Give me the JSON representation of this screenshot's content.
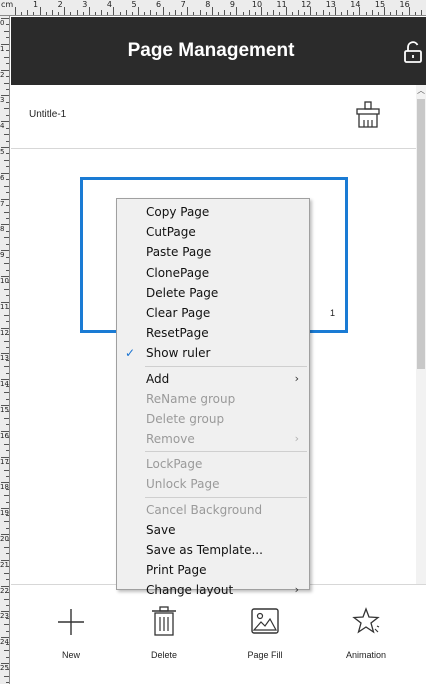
{
  "ruler": {
    "unit": "cm",
    "top_numbers": [
      "0",
      "1",
      "2",
      "3",
      "4",
      "5",
      "6",
      "7",
      "8",
      "9",
      "10",
      "11",
      "12",
      "13",
      "14",
      "15",
      "16"
    ],
    "left_numbers": [
      "0",
      "1",
      "2",
      "3",
      "4",
      "5",
      "6",
      "7",
      "8",
      "9",
      "10",
      "11",
      "12",
      "13",
      "14",
      "15",
      "16",
      "17",
      "18",
      "19",
      "20",
      "21",
      "22",
      "23",
      "24",
      "25",
      "26"
    ]
  },
  "header": {
    "title": "Page Management",
    "lock_icon": "unlock-icon"
  },
  "group": {
    "name": "Untitle-1",
    "clean_icon": "broom-icon"
  },
  "page": {
    "number": "1"
  },
  "context_menu": {
    "sections": [
      [
        {
          "label": "Copy Page",
          "enabled": true,
          "checked": false,
          "submenu": false
        },
        {
          "label": "CutPage",
          "enabled": true,
          "checked": false,
          "submenu": false
        },
        {
          "label": "Paste Page",
          "enabled": true,
          "checked": false,
          "submenu": false
        },
        {
          "label": "ClonePage",
          "enabled": true,
          "checked": false,
          "submenu": false
        },
        {
          "label": "Delete Page",
          "enabled": true,
          "checked": false,
          "submenu": false
        },
        {
          "label": "Clear Page",
          "enabled": true,
          "checked": false,
          "submenu": false
        },
        {
          "label": "ResetPage",
          "enabled": true,
          "checked": false,
          "submenu": false
        },
        {
          "label": "Show ruler",
          "enabled": true,
          "checked": true,
          "submenu": false
        }
      ],
      [
        {
          "label": "Add",
          "enabled": true,
          "checked": false,
          "submenu": true
        },
        {
          "label": "ReName group",
          "enabled": false,
          "checked": false,
          "submenu": false
        },
        {
          "label": "Delete group",
          "enabled": false,
          "checked": false,
          "submenu": false
        },
        {
          "label": "Remove",
          "enabled": false,
          "checked": false,
          "submenu": true
        }
      ],
      [
        {
          "label": "LockPage",
          "enabled": false,
          "checked": false,
          "submenu": false
        },
        {
          "label": "Unlock Page",
          "enabled": false,
          "checked": false,
          "submenu": false
        }
      ],
      [
        {
          "label": "Cancel Background",
          "enabled": false,
          "checked": false,
          "submenu": false
        },
        {
          "label": "Save",
          "enabled": true,
          "checked": false,
          "submenu": false
        },
        {
          "label": "Save as Template...",
          "enabled": true,
          "checked": false,
          "submenu": false
        },
        {
          "label": "Print Page",
          "enabled": true,
          "checked": false,
          "submenu": false
        },
        {
          "label": "Change layout",
          "enabled": true,
          "checked": false,
          "submenu": true
        }
      ]
    ],
    "check_glyph": "✓",
    "arrow_glyph": "›"
  },
  "toolbar": {
    "items": [
      {
        "label": "New",
        "icon": "plus-icon"
      },
      {
        "label": "Delete",
        "icon": "trash-icon"
      },
      {
        "label": "Page Fill",
        "icon": "image-icon"
      },
      {
        "label": "Animation",
        "icon": "star-icon"
      }
    ]
  },
  "colors": {
    "header_bg": "#2b2b2b",
    "accent_blue": "#1a7bd4",
    "menu_bg": "#f0f0f0"
  }
}
